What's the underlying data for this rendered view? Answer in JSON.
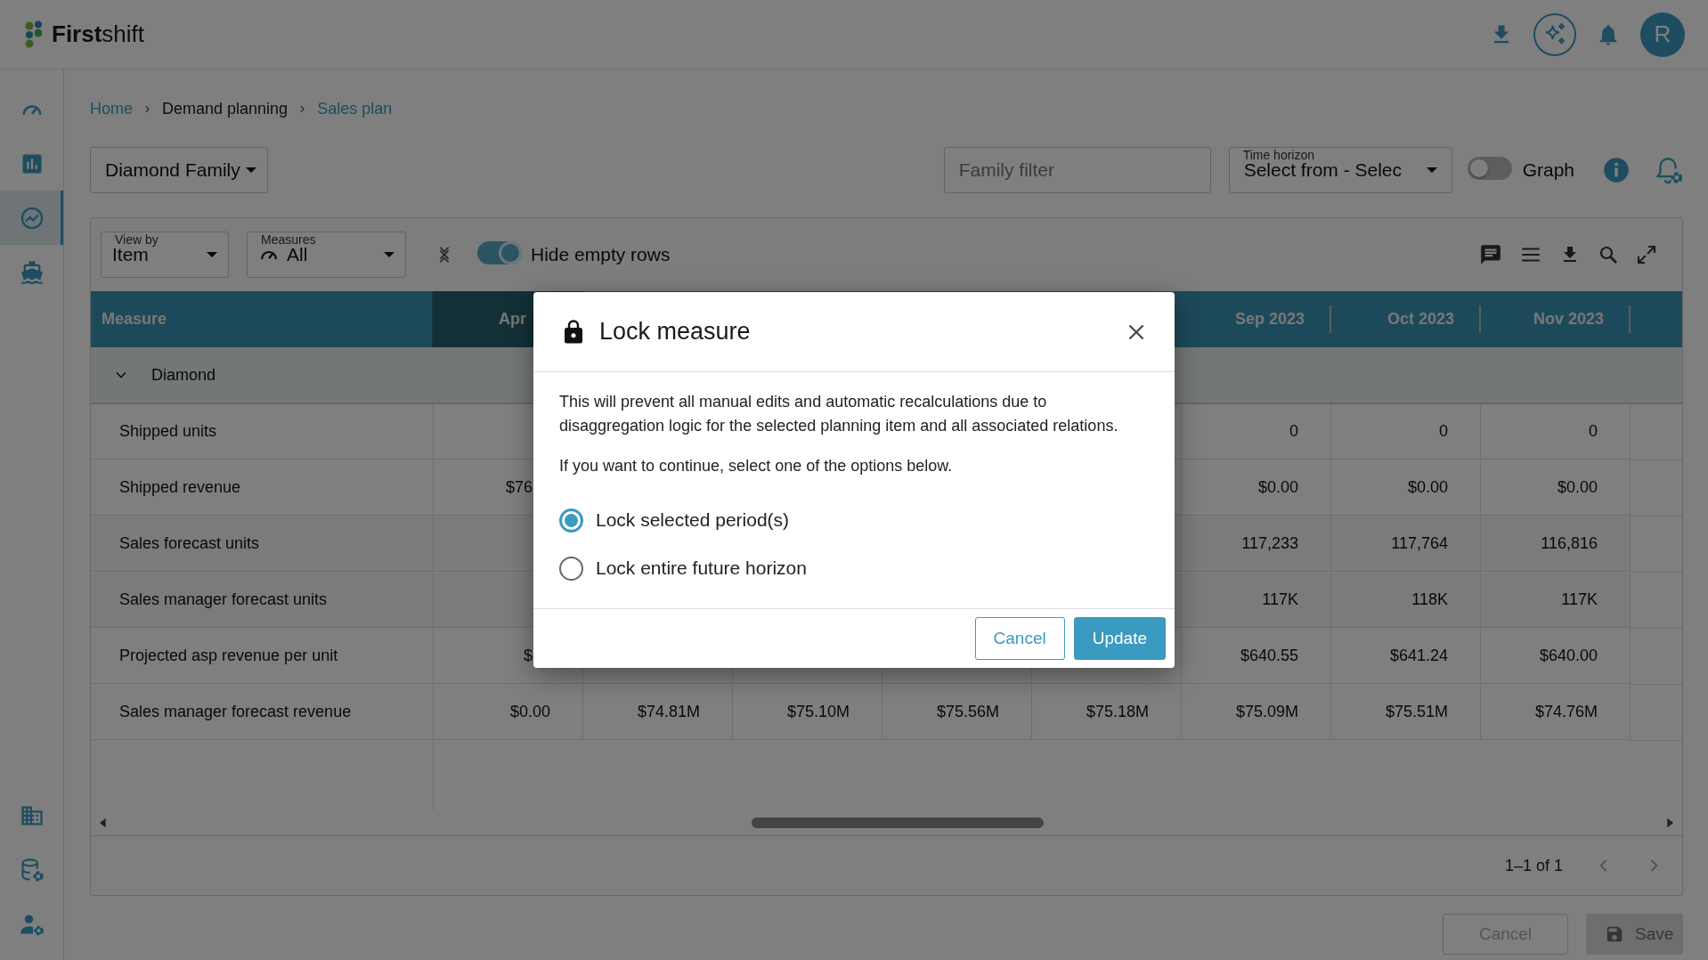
{
  "app": {
    "logo": "**First**shift",
    "avatar": "R"
  },
  "sidebar": {
    "top_items": [
      {
        "kind": "gauge",
        "selected": false
      },
      {
        "kind": "chart",
        "selected": false
      },
      {
        "kind": "trend",
        "selected": true
      },
      {
        "kind": "ship",
        "selected": false
      }
    ],
    "bottom_items": [
      {
        "kind": "building",
        "selected": false
      },
      {
        "kind": "database",
        "selected": false
      },
      {
        "kind": "user",
        "selected": false
      }
    ]
  },
  "breadcrumb": [
    {
      "label": "Home",
      "link": true
    },
    {
      "label": "Demand planning",
      "link": false
    },
    {
      "label": "Sales plan",
      "link": true
    }
  ],
  "filters": {
    "family": "Diamond Family",
    "family_filter_placeholder": "Family filter",
    "time_horizon": {
      "label": "Time horizon",
      "value": "Select from - Selec"
    },
    "graph_toggle": {
      "label": "Graph",
      "on": false
    }
  },
  "toolbar": {
    "view_by": {
      "label": "View by",
      "value": "Item"
    },
    "measures": {
      "label": "Measures",
      "value": "All"
    },
    "hide_empty_rows": {
      "label": "Hide empty rows",
      "on": true
    }
  },
  "table": {
    "measure_header": "Measure",
    "columns": [
      {
        "label": "Apr",
        "selected": true,
        "cut": true
      },
      {},
      {},
      {},
      {},
      {
        "label": "Sep 2023",
        "selected": false
      },
      {
        "label": "Oct 2023",
        "selected": false
      },
      {
        "label": "Nov 2023",
        "selected": false
      }
    ],
    "group": {
      "label": "Diamond",
      "expanded": true
    },
    "rows": [
      {
        "measure": "Shipped units",
        "cells": [
          null,
          null,
          null,
          null,
          null,
          "0",
          "0",
          "0"
        ]
      },
      {
        "measure": "Shipped revenue",
        "cells": [
          {
            "text": "$76",
            "cut": true
          },
          null,
          null,
          null,
          null,
          "$0.00",
          "$0.00",
          "$0.00"
        ]
      },
      {
        "measure": "Sales forecast units",
        "cells": [
          null,
          null,
          null,
          null,
          null,
          "117,233",
          "117,764",
          "116,816"
        ]
      },
      {
        "measure": "Sales manager forecast units",
        "cells": [
          null,
          null,
          null,
          null,
          null,
          "117K",
          "118K",
          "117K"
        ]
      },
      {
        "measure": "Projected asp revenue per unit",
        "cells": [
          {
            "text": "$",
            "cut": true
          },
          null,
          null,
          null,
          null,
          "$640.55",
          "$641.24",
          "$640.00"
        ]
      },
      {
        "measure": "Sales manager forecast revenue",
        "cells": [
          "$0.00",
          "$74.81M",
          "$75.10M",
          "$75.56M",
          "$75.18M",
          "$75.09M",
          "$75.51M",
          "$74.76M"
        ]
      }
    ]
  },
  "pagination": {
    "range": "1–1 of 1"
  },
  "actions": [
    {
      "label": "Cancel",
      "kind": "secondary",
      "disabled": true
    },
    {
      "label": "Save",
      "kind": "primary",
      "disabled": true
    }
  ],
  "dialog": {
    "title": "Lock measure",
    "paragraphs": [
      "This will prevent all manual edits and automatic recalculations due to disaggregation logic for the selected planning item and all associated relations.",
      "If you want to continue, select one of the options below."
    ],
    "options": [
      {
        "label": "Lock selected period(s)",
        "selected": true
      },
      {
        "label": "Lock entire future horizon",
        "selected": false
      }
    ],
    "buttons": [
      {
        "label": "Cancel",
        "kind": "secondary"
      },
      {
        "label": "Update",
        "kind": "primary"
      }
    ]
  }
}
